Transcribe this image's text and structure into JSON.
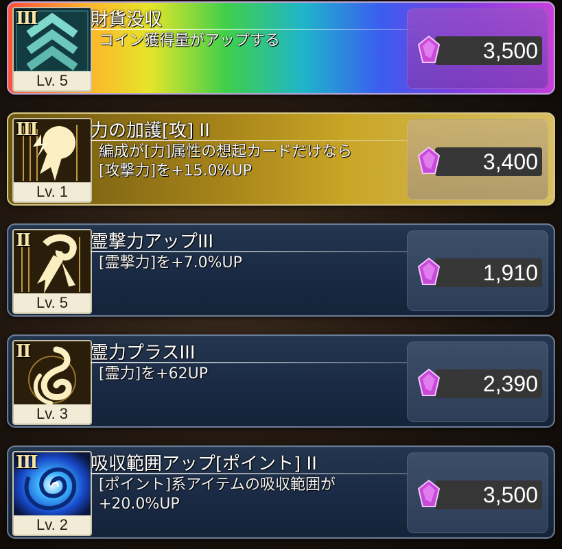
{
  "colors": {
    "gem": "#c84ad8",
    "level_bg": "#f2ecd6",
    "rank_text": "#f6e4a8"
  },
  "items": [
    {
      "rank": "III",
      "level": "Lv. 5",
      "title": "財貨没収",
      "description": "コイン獲得量がアップする",
      "price": "3,500",
      "icon": "chevron-rank-icon",
      "style": "rainbow"
    },
    {
      "rank": "III",
      "level": "Lv. 1",
      "title": "力の加護[攻] II",
      "description": "編成が[力]属性の想起カードだけなら\n[攻撃力]を+15.0%UP",
      "price": "3,400",
      "icon": "power-fist-icon",
      "style": "gold"
    },
    {
      "rank": "II",
      "level": "Lv. 5",
      "title": "霊撃力アップIII",
      "description": "[霊撃力]を+7.0%UP",
      "price": "1,910",
      "icon": "spirit-strike-icon",
      "style": "normal"
    },
    {
      "rank": "II",
      "level": "Lv. 3",
      "title": "霊力プラスIII",
      "description": "[霊力]を+62UP",
      "price": "2,390",
      "icon": "spirit-flame-icon",
      "style": "normal"
    },
    {
      "rank": "III",
      "level": "Lv. 2",
      "title": "吸収範囲アップ[ポイント] II",
      "description": "[ポイント]系アイテムの吸収範囲が\n+20.0%UP",
      "price": "3,500",
      "icon": "vortex-icon",
      "style": "normal"
    }
  ]
}
